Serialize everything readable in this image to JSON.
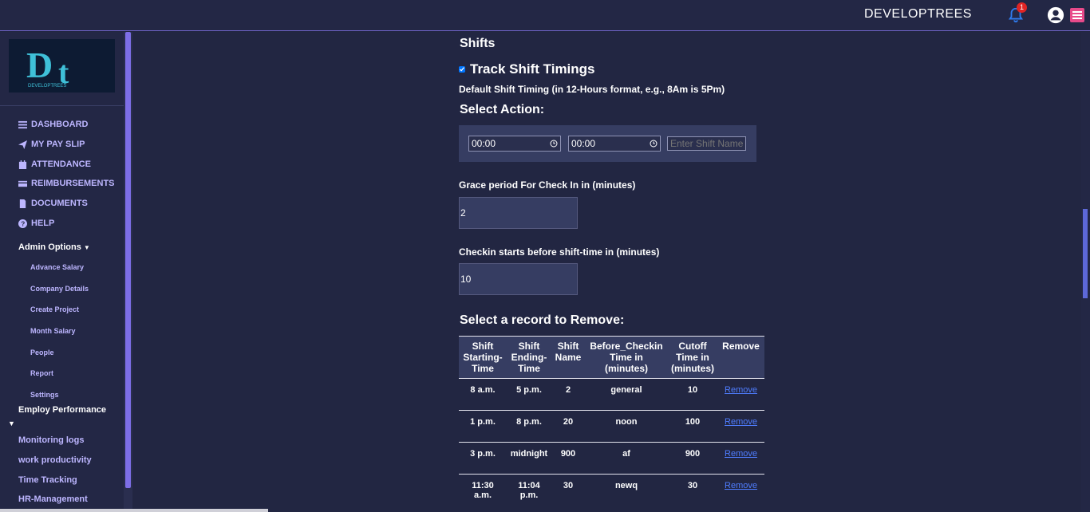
{
  "header": {
    "brand": "DEVELOPTREES",
    "notification_count": "1"
  },
  "sidebar": {
    "nav": [
      {
        "label": "DASHBOARD",
        "icon": "bars-icon"
      },
      {
        "label": "MY PAY SLIP",
        "icon": "send-icon"
      },
      {
        "label": "ATTENDANCE",
        "icon": "calendar-icon"
      },
      {
        "label": "REIMBURSEMENTS",
        "icon": "card-icon"
      },
      {
        "label": "DOCUMENTS",
        "icon": "file-icon"
      },
      {
        "label": "HELP",
        "icon": "question-icon"
      }
    ],
    "admin_options": "Admin Options",
    "admin_items": [
      "Advance Salary",
      "Company Details",
      "Create Project",
      "Month Salary",
      "People",
      "Report",
      "Settings"
    ],
    "employ_performance": "Employ Performance",
    "links": [
      "Monitoring logs",
      "work productivity",
      "Time Tracking",
      "HR-Management"
    ]
  },
  "main": {
    "shifts_title": "Shifts",
    "track_shift_label": "Track Shift Timings",
    "track_shift_checked": true,
    "default_timing_text": "Default Shift Timing (in 12-Hours format, e.g., 8Am is 5Pm)",
    "select_action_title": "Select Action:",
    "start_time": "00:00",
    "end_time": "00:00",
    "shift_name_placeholder": "Enter Shift Name",
    "grace_label": "Grace period For Check In in (minutes)",
    "grace_value": "2",
    "checkin_label": "Checkin starts before shift-time in (minutes)",
    "checkin_value": "10",
    "remove_title": "Select a record to Remove:",
    "table": {
      "headers": [
        "Shift Starting-Time",
        "Shift Ending-Time",
        "Shift Name",
        "Before_Checkin Time in (minutes)",
        "Cutoff Time in (minutes)",
        "Remove"
      ],
      "rows": [
        [
          "8 a.m.",
          "5 p.m.",
          "2",
          "general",
          "10",
          "Remove"
        ],
        [
          "1 p.m.",
          "8 p.m.",
          "20",
          "noon",
          "100",
          "Remove"
        ],
        [
          "3 p.m.",
          "midnight",
          "900",
          "af",
          "900",
          "Remove"
        ],
        [
          "11:30 a.m.",
          "11:04 p.m.",
          "30",
          "newq",
          "30",
          "Remove"
        ]
      ]
    }
  },
  "colors": {
    "background": "#222642",
    "accent": "#7d6ee6",
    "nav_text": "#bdb6ff",
    "link": "#4f7dff",
    "badge": "#e02424",
    "menu_button": "#e84a8a"
  }
}
